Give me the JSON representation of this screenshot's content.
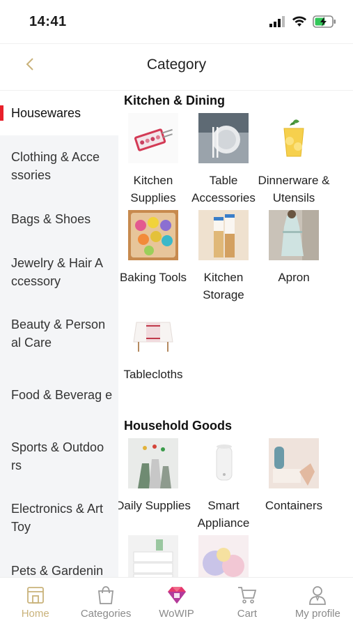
{
  "status_bar": {
    "time": "14:41"
  },
  "header": {
    "title": "Category"
  },
  "sidebar": {
    "items": [
      {
        "label": "Housewares",
        "active": true
      },
      {
        "label": "Clothing & Acce ssories"
      },
      {
        "label": "Bags & Shoes"
      },
      {
        "label": "Jewelry & Hair A ccessory"
      },
      {
        "label": "Beauty & Person al Care"
      },
      {
        "label": "Food & Beverag e"
      },
      {
        "label": "Sports & Outdoo rs"
      },
      {
        "label": "Electronics & Art Toy"
      },
      {
        "label": "Pets & Gardenin"
      }
    ]
  },
  "content": {
    "sections": [
      {
        "title": "Kitchen & Dining",
        "tiles": [
          {
            "label": "Kitchen Supplies",
            "icon": "kitchen-supplies-image"
          },
          {
            "label": "Table Accessories",
            "icon": "table-accessories-image"
          },
          {
            "label": "Dinnerware & Utensils",
            "icon": "dinnerware-image"
          },
          {
            "label": "Baking Tools",
            "icon": "baking-tools-image"
          },
          {
            "label": "Kitchen Storage",
            "icon": "kitchen-storage-image"
          },
          {
            "label": "Apron",
            "icon": "apron-image"
          },
          {
            "label": "Tablecloths",
            "icon": "tablecloths-image"
          }
        ]
      },
      {
        "title": "Household Goods",
        "tiles": [
          {
            "label": "Daily Supplies",
            "icon": "daily-supplies-image"
          },
          {
            "label": "Smart Appliance",
            "icon": "smart-appliance-image"
          },
          {
            "label": "Containers",
            "icon": "containers-image"
          },
          {
            "label": "",
            "icon": "stacked-boxes-image"
          },
          {
            "label": "",
            "icon": "pillows-image"
          }
        ]
      }
    ]
  },
  "tabbar": {
    "items": [
      {
        "label": "Home",
        "active": true,
        "icon": "home-icon"
      },
      {
        "label": "Categories",
        "icon": "categories-bag-icon"
      },
      {
        "label": "WoWIP",
        "icon": "wowip-diamond-icon"
      },
      {
        "label": "Cart",
        "icon": "cart-icon"
      },
      {
        "label": "My profile",
        "icon": "profile-icon"
      }
    ]
  },
  "colors": {
    "accent": "#e8202a",
    "active_tab": "#c9b27a",
    "sidebar_bg": "#f4f5f7"
  }
}
